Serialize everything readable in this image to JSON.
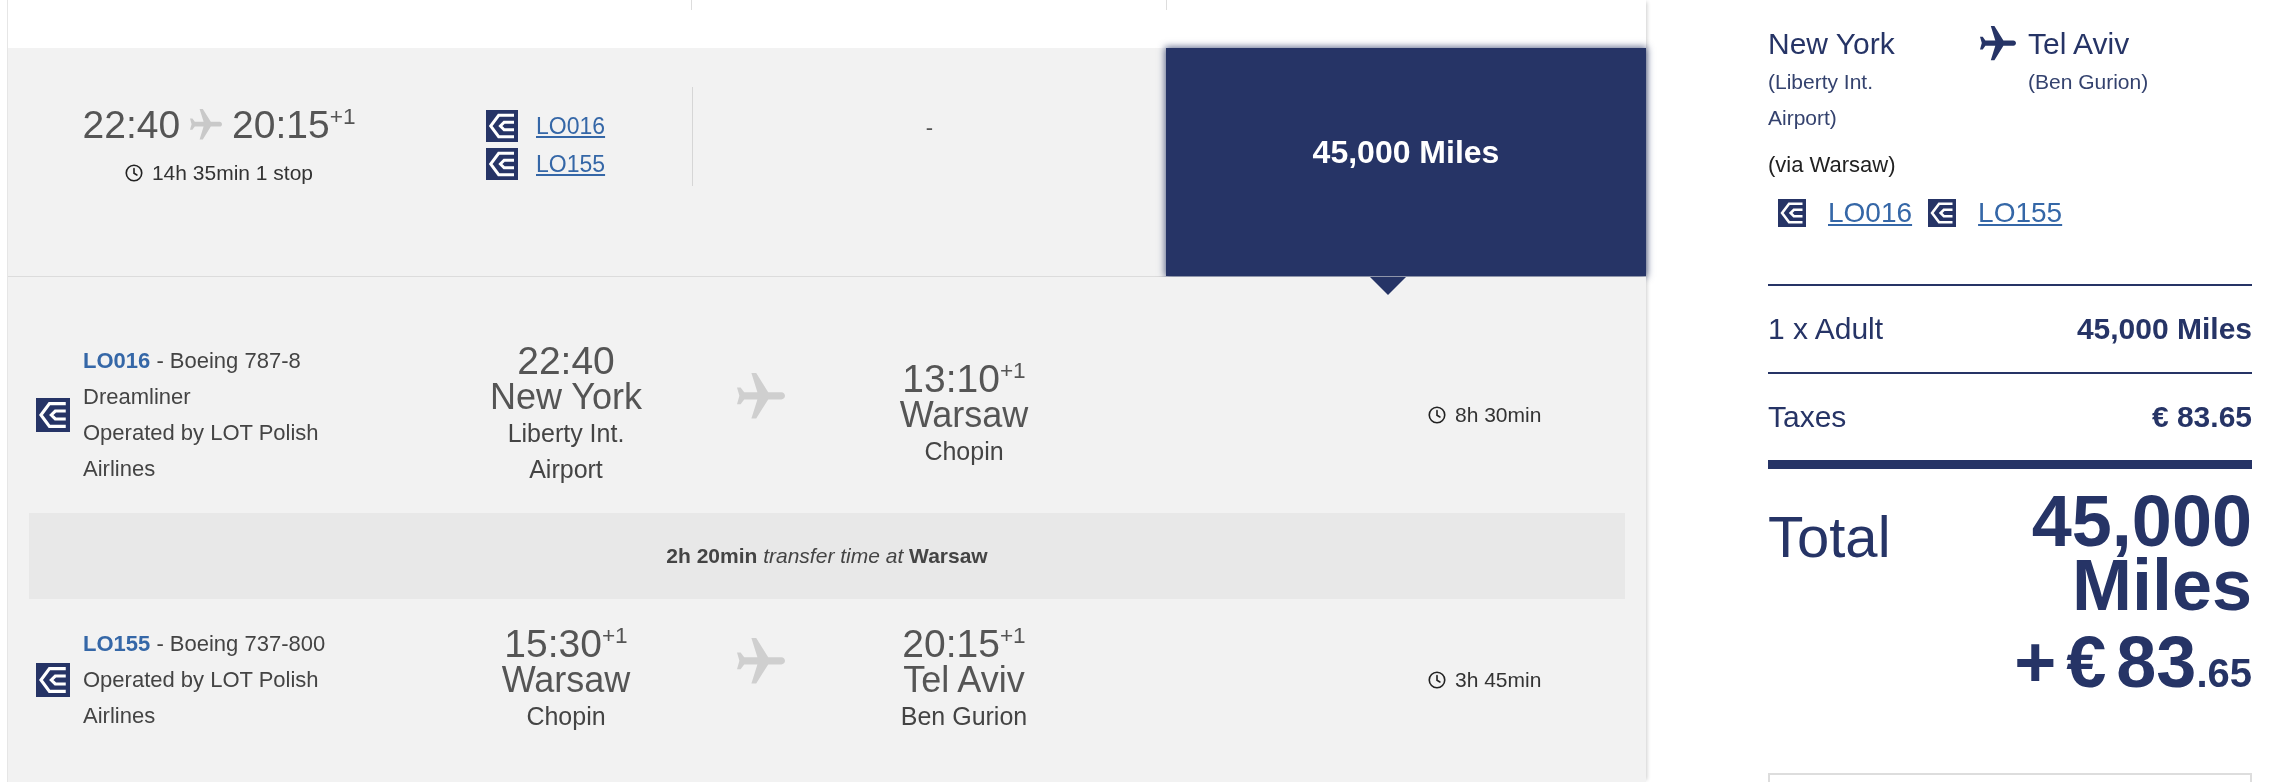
{
  "results": [
    {
      "selected": true,
      "expanded": true,
      "departure_time": "22:40",
      "arrival_time": "20:15",
      "arrival_day_offset": "+1",
      "duration": "14h 35min 1 stop",
      "flights": [
        "LO016",
        "LO155"
      ],
      "column_3": "-",
      "price": "45,000 Miles",
      "segments": [
        {
          "kind": "flight",
          "flight_number": "LO016",
          "aircraft": "- Boeing 787-8 Dreamliner",
          "operator": "Operated by LOT Polish Airlines",
          "departure": {
            "time": "22:40",
            "city": "New York",
            "airport": "Liberty Int. Airport"
          },
          "arrival": {
            "time": "13:10",
            "day_offset": "+1",
            "city": "Warsaw",
            "airport": "Chopin"
          },
          "duration": "8h 30min"
        },
        {
          "kind": "transfer",
          "text": "**2h 20min** *transfer time at* **Warsaw**"
        },
        {
          "kind": "flight",
          "flight_number": "LO155",
          "aircraft": "- Boeing 737-800",
          "operator": "Operated by LOT Polish Airlines",
          "departure": {
            "time": "15:30",
            "day_offset": "+1",
            "city": "Warsaw",
            "airport": "Chopin"
          },
          "arrival": {
            "time": "20:15",
            "day_offset": "+1",
            "city": "Tel Aviv",
            "airport": "Ben Gurion"
          },
          "duration": "3h 45min"
        }
      ]
    }
  ],
  "summary": {
    "origin": {
      "city": "New York",
      "airport": "(Liberty Int. Airport)"
    },
    "destination": {
      "city": "Tel Aviv",
      "airport": "(Ben Gurion)"
    },
    "via": "(via Warsaw)",
    "flights": [
      "LO016",
      "LO155"
    ],
    "lines": [
      {
        "label": "1 x Adult",
        "value": "45,000 Miles"
      },
      {
        "label": "Taxes",
        "value": "€ 83.65"
      }
    ],
    "total": {
      "label": "Total",
      "miles": "45,000 Miles",
      "cash": "+ € 83",
      "cash_fraction": ".65"
    }
  }
}
